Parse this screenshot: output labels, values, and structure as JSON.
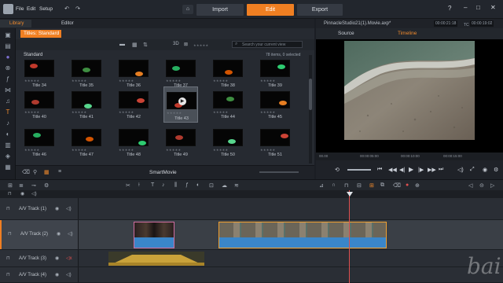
{
  "menu": {
    "file": "File",
    "edit": "Edit",
    "setup": "Setup"
  },
  "modes": {
    "import": "Import",
    "edit": "Edit",
    "export": "Export"
  },
  "panel_tabs": {
    "library": "Library",
    "editor": "Editor"
  },
  "library": {
    "category": "Titles: Standard",
    "search_placeholder": "Search your current view",
    "section": "Standard",
    "count": "78 items, 0 selected",
    "footer": "SmartMovie",
    "titles": [
      "Title 34",
      "Title 35",
      "Title 36",
      "Title 37",
      "Title 38",
      "Title 39",
      "Title 40",
      "Title 41",
      "Title 42",
      "Title 43",
      "Title 44",
      "Title 45",
      "Title 46",
      "Title 47",
      "Title 48",
      "Title 49",
      "Title 50",
      "Title 51"
    ],
    "selected_index": 9,
    "stars": "★★★★★"
  },
  "preview": {
    "project_title": "PinnacleStudio21(1).Movie.axp*",
    "timecode_tc": "00:00:21:18",
    "timecode_dur": "00:00:19:02",
    "tab_source": "Source",
    "tab_timeline": "Timeline",
    "ruler_ticks": [
      "00.00",
      "00:00:05:00",
      "00:00:10:00",
      "00:00:15:00"
    ]
  },
  "tracks": [
    {
      "name": "A/V Track (1)"
    },
    {
      "name": "A/V Track (2)"
    },
    {
      "name": "A/V Track (3)"
    },
    {
      "name": "A/V Track (4)"
    }
  ],
  "watermark": "bai",
  "colors": {
    "accent": "#f07f22",
    "clip_pink": "#d27aa3",
    "clip_orange": "#f0a030",
    "audio_blue": "#3a86c9"
  }
}
